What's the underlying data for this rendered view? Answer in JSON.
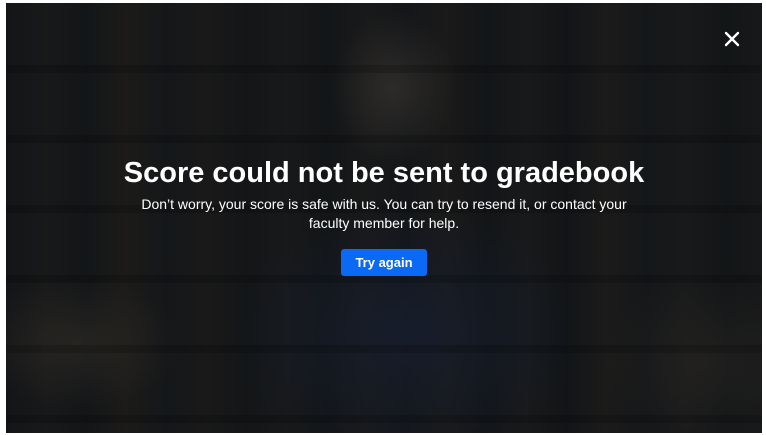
{
  "dialog": {
    "title": "Score could not be sent to gradebook",
    "message": "Don’t worry, your score is safe with us. You can try to resend it, or contact your faculty member for help.",
    "retry_label": "Try again",
    "close_icon": "close-icon"
  },
  "colors": {
    "primary_button": "#0b6af5",
    "text": "#ffffff"
  }
}
